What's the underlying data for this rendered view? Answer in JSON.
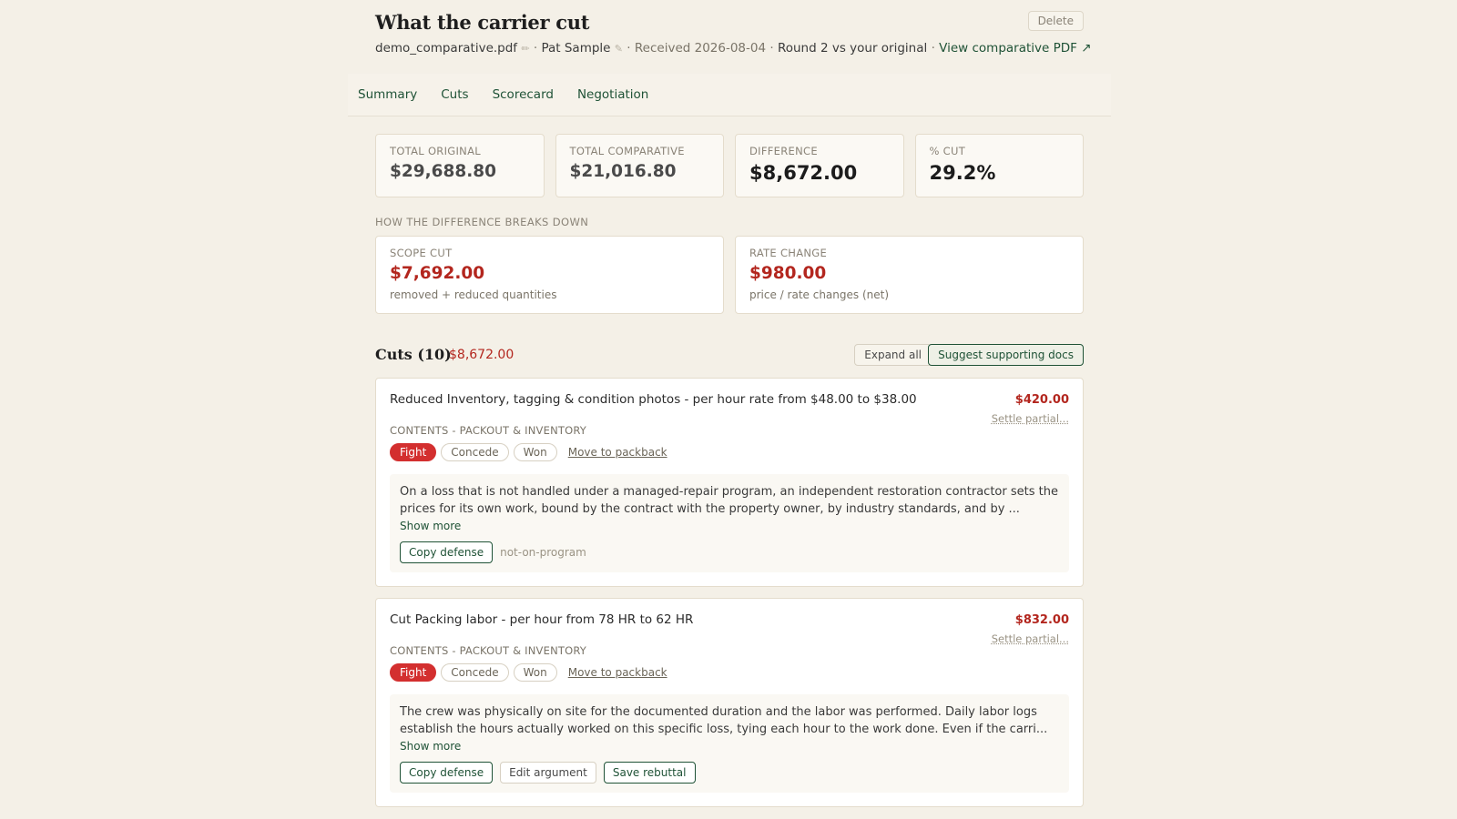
{
  "header": {
    "title": "What the carrier cut",
    "delete_label": "Delete",
    "filename": "demo_comparative.pdf",
    "owner": "Pat Sample",
    "received": "Received 2026-08-04",
    "round": "Round 2 vs your original",
    "view_link": "View comparative PDF ↗",
    "separator": "·"
  },
  "tabs": [
    "Summary",
    "Cuts",
    "Scorecard",
    "Negotiation"
  ],
  "stats": [
    {
      "label": "TOTAL ORIGINAL",
      "value": "$29,688.80"
    },
    {
      "label": "TOTAL COMPARATIVE",
      "value": "$21,016.80"
    },
    {
      "label": "DIFFERENCE",
      "value": "$8,672.00"
    },
    {
      "label": "% CUT",
      "value": "29.2%"
    }
  ],
  "breakdown": {
    "heading": "HOW THE DIFFERENCE BREAKS DOWN",
    "items": [
      {
        "label": "SCOPE CUT",
        "value": "$7,692.00",
        "sub": "removed + reduced quantities"
      },
      {
        "label": "RATE CHANGE",
        "value": "$980.00",
        "sub": "price / rate changes (net)"
      }
    ]
  },
  "cuts": {
    "title": "Cuts (10)",
    "total": "$8,672.00",
    "expand_label": "Expand all",
    "suggest_label": "Suggest supporting docs",
    "items": [
      {
        "desc": "Reduced Inventory, tagging & condition photos - per hour rate from $48.00 to $38.00",
        "amount": "$420.00",
        "settle": "Settle partial...",
        "category": "CONTENTS - PACKOUT & INVENTORY",
        "chips": [
          "Fight",
          "Concede",
          "Won"
        ],
        "move": "Move to packback",
        "defense": "On a loss that is not handled under a managed-repair program, an independent restoration contractor sets the prices for its own work, bound by the contract with the property owner, by industry standards, and by ...",
        "show_more": "Show more",
        "copy": "Copy defense",
        "tag": "not-on-program"
      },
      {
        "desc": "Cut Packing labor - per hour from 78 HR to 62 HR",
        "amount": "$832.00",
        "settle": "Settle partial...",
        "category": "CONTENTS - PACKOUT & INVENTORY",
        "chips": [
          "Fight",
          "Concede",
          "Won"
        ],
        "move": "Move to packback",
        "defense": "The crew was physically on site for the documented duration and the labor was performed. Daily labor logs establish the hours actually worked on this specific loss, tying each hour to the work done. Even if the carri...",
        "show_more": "Show more",
        "copy": "Copy defense",
        "edit": "Edit argument",
        "save": "Save rebuttal"
      }
    ]
  }
}
